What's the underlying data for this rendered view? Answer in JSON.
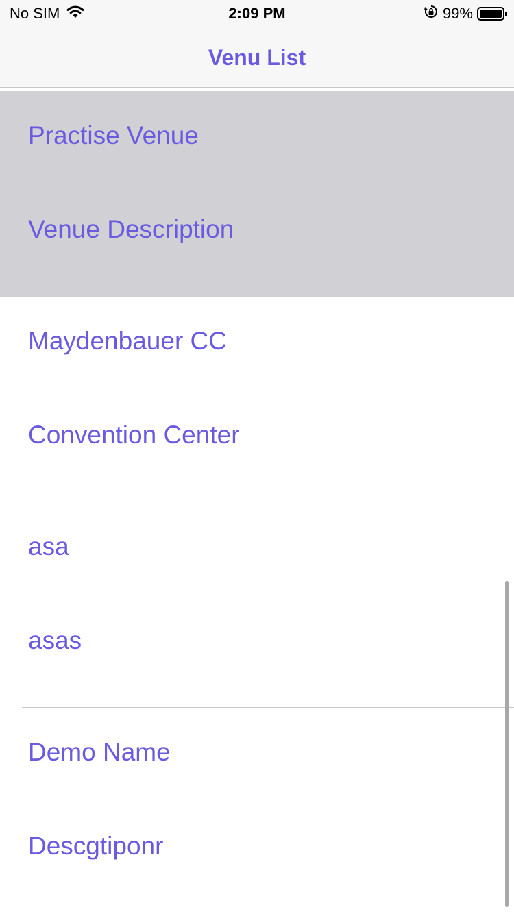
{
  "status_bar": {
    "carrier": "No SIM",
    "time": "2:09 PM",
    "battery_percent": "99%",
    "battery_level": 0.99,
    "icons": [
      "wifi-icon",
      "rotation-lock-icon",
      "battery-icon"
    ]
  },
  "nav": {
    "title": "Venu List"
  },
  "colors": {
    "accent": "#6a5ae0",
    "selected_row": "#d1d0d5",
    "bar_background": "#f7f7f7"
  },
  "venues": [
    {
      "name": "Practise Venue",
      "description": "Venue Description",
      "selected": true
    },
    {
      "name": "Maydenbauer CC",
      "description": "Convention Center",
      "selected": false
    },
    {
      "name": "asa",
      "description": "asas",
      "selected": false
    },
    {
      "name": "Demo Name",
      "description": "Descgtiponr",
      "selected": false
    }
  ]
}
